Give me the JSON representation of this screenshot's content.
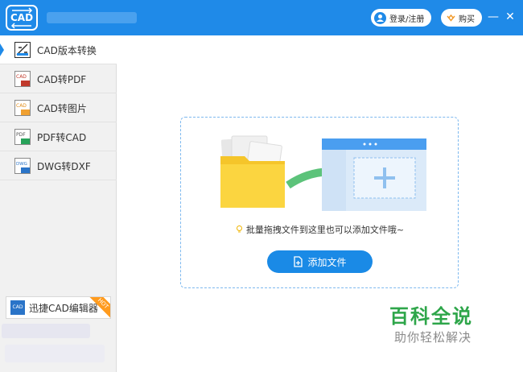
{
  "app": {
    "logo_text": "CAD"
  },
  "titlebar": {
    "login_label": "登录/注册",
    "buy_label": "购买",
    "minimize_label": "—",
    "close_label": "✕"
  },
  "sidebar": {
    "items": [
      {
        "label": "CAD版本转换",
        "icon": "cad-version-icon",
        "active": true
      },
      {
        "label": "CAD转PDF",
        "icon": "cad-to-pdf-icon"
      },
      {
        "label": "CAD转图片",
        "icon": "cad-to-image-icon"
      },
      {
        "label": "PDF转CAD",
        "icon": "pdf-to-cad-icon"
      },
      {
        "label": "DWG转DXF",
        "icon": "dwg-to-dxf-icon"
      }
    ],
    "editor_label": "迅捷CAD编辑器",
    "editor_badge": "HOT",
    "editor_icon_text": "CAD"
  },
  "main": {
    "drop_hint": "批量拖拽文件到这里也可以添加文件哦~",
    "add_file_label": "添加文件"
  },
  "watermark": {
    "title": "百科全说",
    "subtitle": "助你轻松解决"
  },
  "colors": {
    "accent": "#1f8ae8",
    "folder": "#f5c52a",
    "arrow": "#5cc37a",
    "watermark_green": "#2ea64a",
    "hot_badge": "#ff9b1e"
  }
}
